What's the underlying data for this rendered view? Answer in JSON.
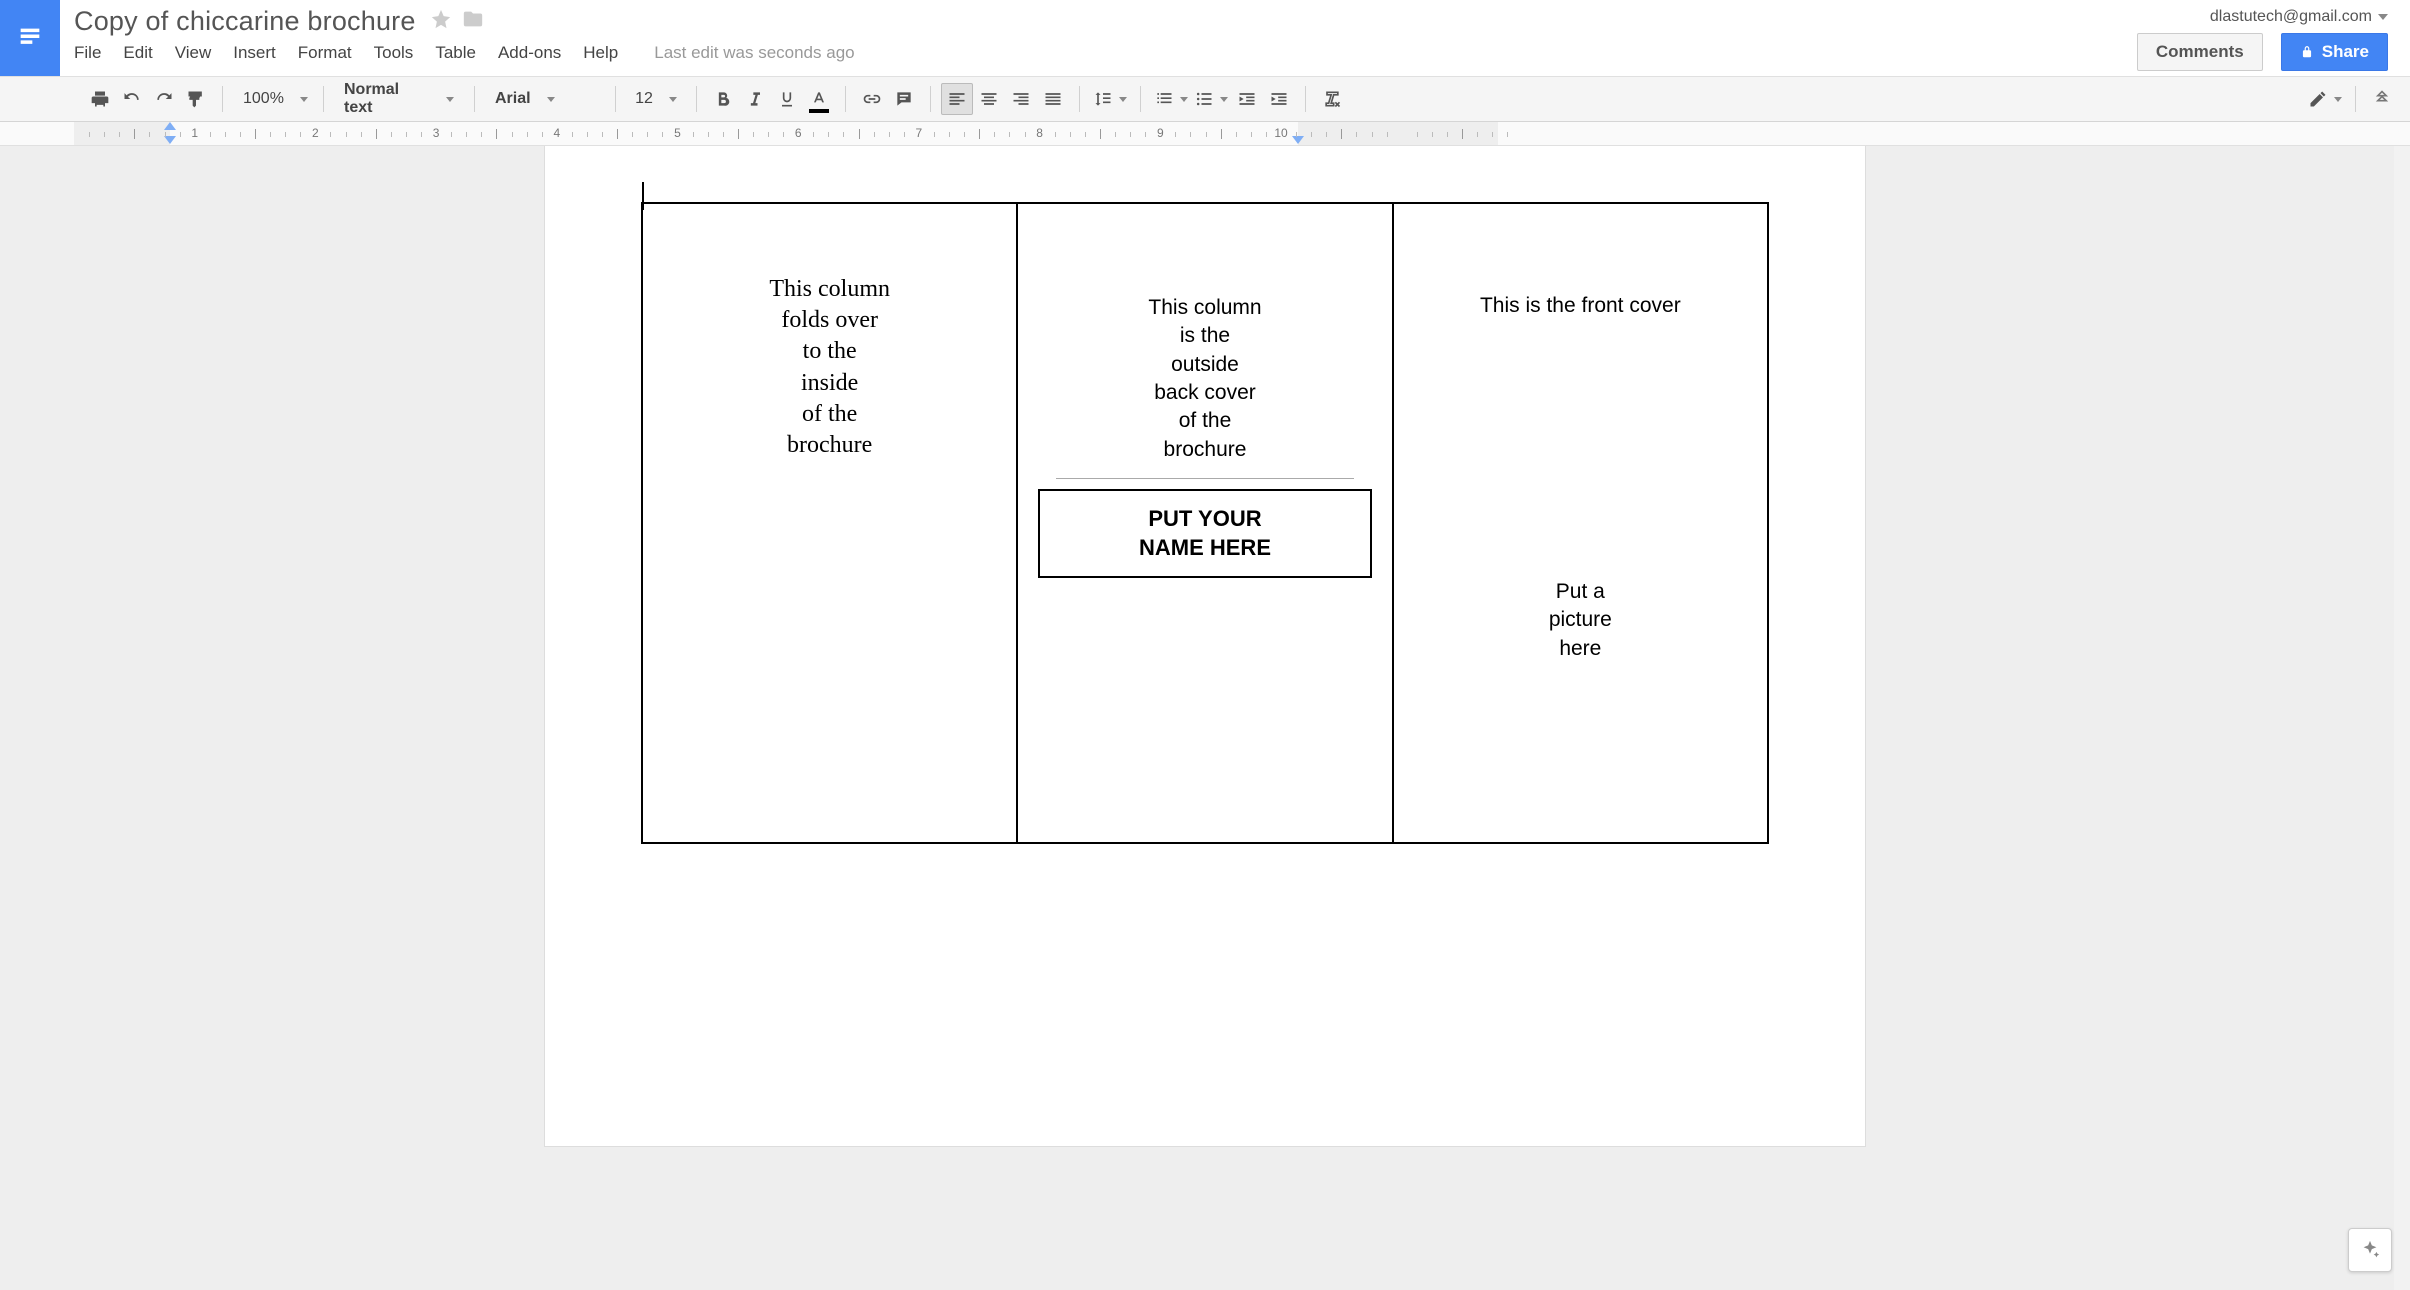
{
  "account_email": "dlastutech@gmail.com",
  "doc_title": "Copy of chiccarine brochure",
  "menu": {
    "file": "File",
    "edit": "Edit",
    "view": "View",
    "insert": "Insert",
    "format": "Format",
    "tools": "Tools",
    "table": "Table",
    "addons": "Add-ons",
    "help": "Help"
  },
  "last_edit": "Last edit was seconds ago",
  "buttons": {
    "comments": "Comments",
    "share": "Share"
  },
  "toolbar": {
    "zoom": "100%",
    "paragraph_style": "Normal text",
    "font_family": "Arial",
    "font_size": "12"
  },
  "ruler": {
    "numbers": [
      "1",
      "2",
      "3",
      "4",
      "5",
      "6",
      "7",
      "8",
      "9",
      "10"
    ]
  },
  "document": {
    "col1": "This column\nfolds over\nto the\ninside\nof the\nbrochure",
    "col2_text": "This column\nis the\noutside\nback cover\nof the\nbrochure",
    "col2_namebox": "PUT YOUR\nNAME HERE",
    "col3_title": "This is the front cover",
    "col3_pic": "Put a\npicture\nhere"
  }
}
